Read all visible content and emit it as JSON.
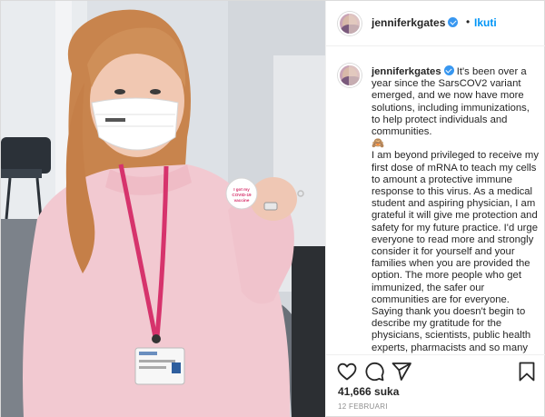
{
  "post": {
    "author": {
      "username": "jenniferkgates",
      "verified": true
    },
    "follow_label": "Ikuti",
    "separator": "•",
    "caption": {
      "username": "jenniferkgates",
      "text": "It's been over a year since the SarsCOV2 variant emerged, and we now have more solutions, including immunizations, to help protect individuals and communities.\n🙈\nI am beyond privileged to receive my first dose of mRNA to teach my cells to amount a protective immune response to this virus. As a medical student and aspiring physician, I am grateful it will give me protection and safety for my future practice. I'd urge everyone to read more and strongly consider it for yourself and your families when you are provided the option. The more people who get immunized, the safer our communities are for everyone. Saying thank you doesn't begin to describe my gratitude for the physicians, scientists, public health experts, pharmacists and so many others who made this achievement in"
    },
    "photo": {
      "sticker_text": "I got my COVID-19 vaccine"
    },
    "actions": {
      "like_icon": "heart-icon",
      "comment_icon": "comment-icon",
      "share_icon": "paper-plane-icon",
      "save_icon": "bookmark-icon"
    },
    "likes_label": "41,666 suka",
    "date_label": "12 FEBRUARI",
    "colors": {
      "accent": "#0095f6",
      "verified": "#3897f0",
      "text": "#262626",
      "muted": "#8e8e8e",
      "border": "#dbdbdb"
    }
  }
}
